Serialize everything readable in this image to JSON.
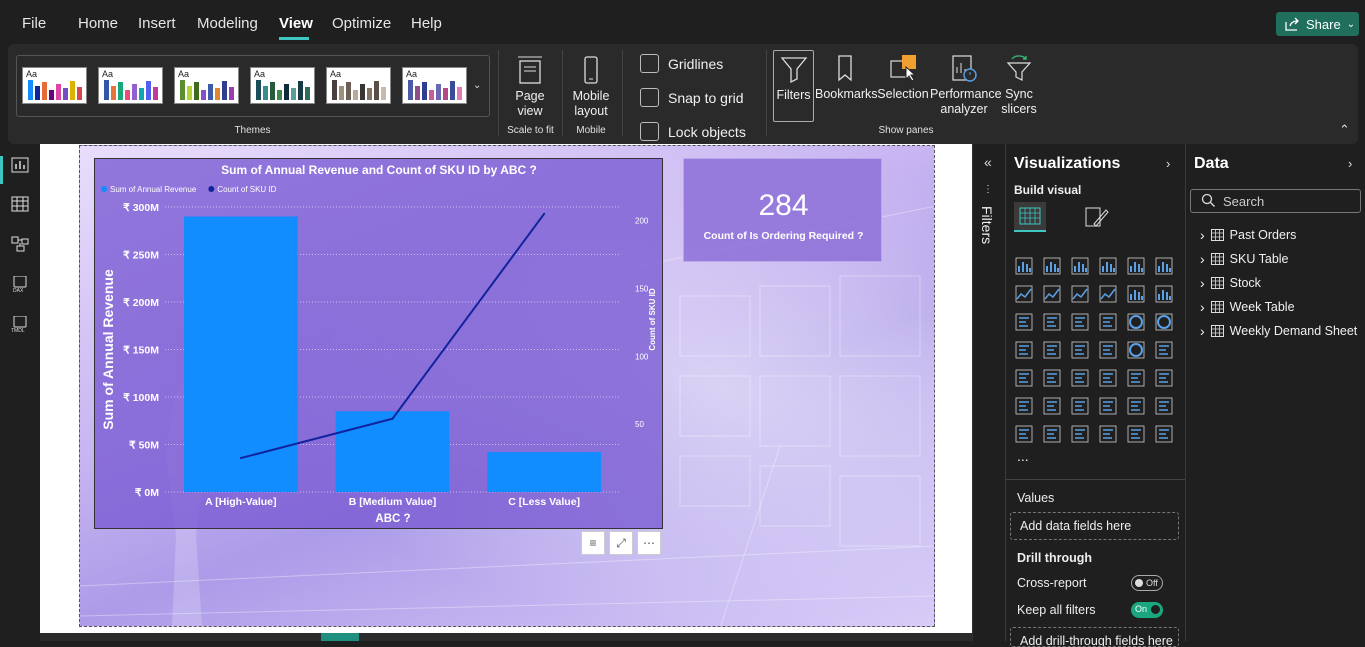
{
  "menu": {
    "file": "File",
    "home": "Home",
    "insert": "Insert",
    "modeling": "Modeling",
    "view": "View",
    "optimize": "Optimize",
    "help": "Help",
    "share": "Share"
  },
  "ribbon": {
    "themes_label": "Themes",
    "theme_aa": "Aa",
    "page_view": "Page view",
    "scale_to_fit": "Scale to fit",
    "mobile_layout": "Mobile layout",
    "mobile": "Mobile",
    "gridlines": "Gridlines",
    "snap_to_grid": "Snap to grid",
    "lock_objects": "Lock objects",
    "filters": "Filters",
    "bookmarks": "Bookmarks",
    "selection": "Selection",
    "performance_analyzer": "Performance analyzer",
    "sync_slicers": "Sync slicers",
    "show_panes": "Show panes"
  },
  "chart_data": {
    "type": "bar",
    "title": "Sum of Annual Revenue and Count of SKU ID by ABC ?",
    "categories": [
      "A [High-Value]",
      "B [Medium Value]",
      "C [Less Value]"
    ],
    "series": [
      {
        "name": "Sum of Annual Revenue",
        "type": "bar",
        "values": [
          290,
          85,
          42
        ],
        "color": "#118dff",
        "axis": "left"
      },
      {
        "name": "Count of SKU ID",
        "type": "line",
        "values": [
          25,
          54,
          205
        ],
        "color": "#12239e",
        "axis": "right"
      }
    ],
    "xlabel": "ABC ?",
    "ylabel": "Sum of Annual Revenue",
    "y2label": "Count of SKU ID",
    "ylim": [
      0,
      300
    ],
    "y2lim": [
      0,
      210
    ],
    "yticks": [
      "₹ 0M",
      "₹ 50M",
      "₹ 100M",
      "₹ 150M",
      "₹ 200M",
      "₹ 250M",
      "₹ 300M"
    ],
    "y2ticks": [
      "50",
      "100",
      "150",
      "200"
    ],
    "legend": "top-left"
  },
  "card": {
    "value": "284",
    "label": "Count of Is Ordering Required ?"
  },
  "filters_label": "Filters",
  "viz": {
    "title": "Visualizations",
    "build_visual": "Build visual",
    "more": "...",
    "values": "Values",
    "add_data_fields": "Add data fields here",
    "drill_through": "Drill through",
    "cross_report": "Cross-report",
    "cross_report_state": "Off",
    "keep_all_filters": "Keep all filters",
    "keep_all_filters_state": "On",
    "add_drill_fields": "Add drill-through fields here"
  },
  "data": {
    "title": "Data",
    "search_placeholder": "Search",
    "tables": [
      "Past Orders",
      "SKU Table",
      "Stock",
      "Week Table",
      "Weekly Demand Sheet"
    ]
  }
}
